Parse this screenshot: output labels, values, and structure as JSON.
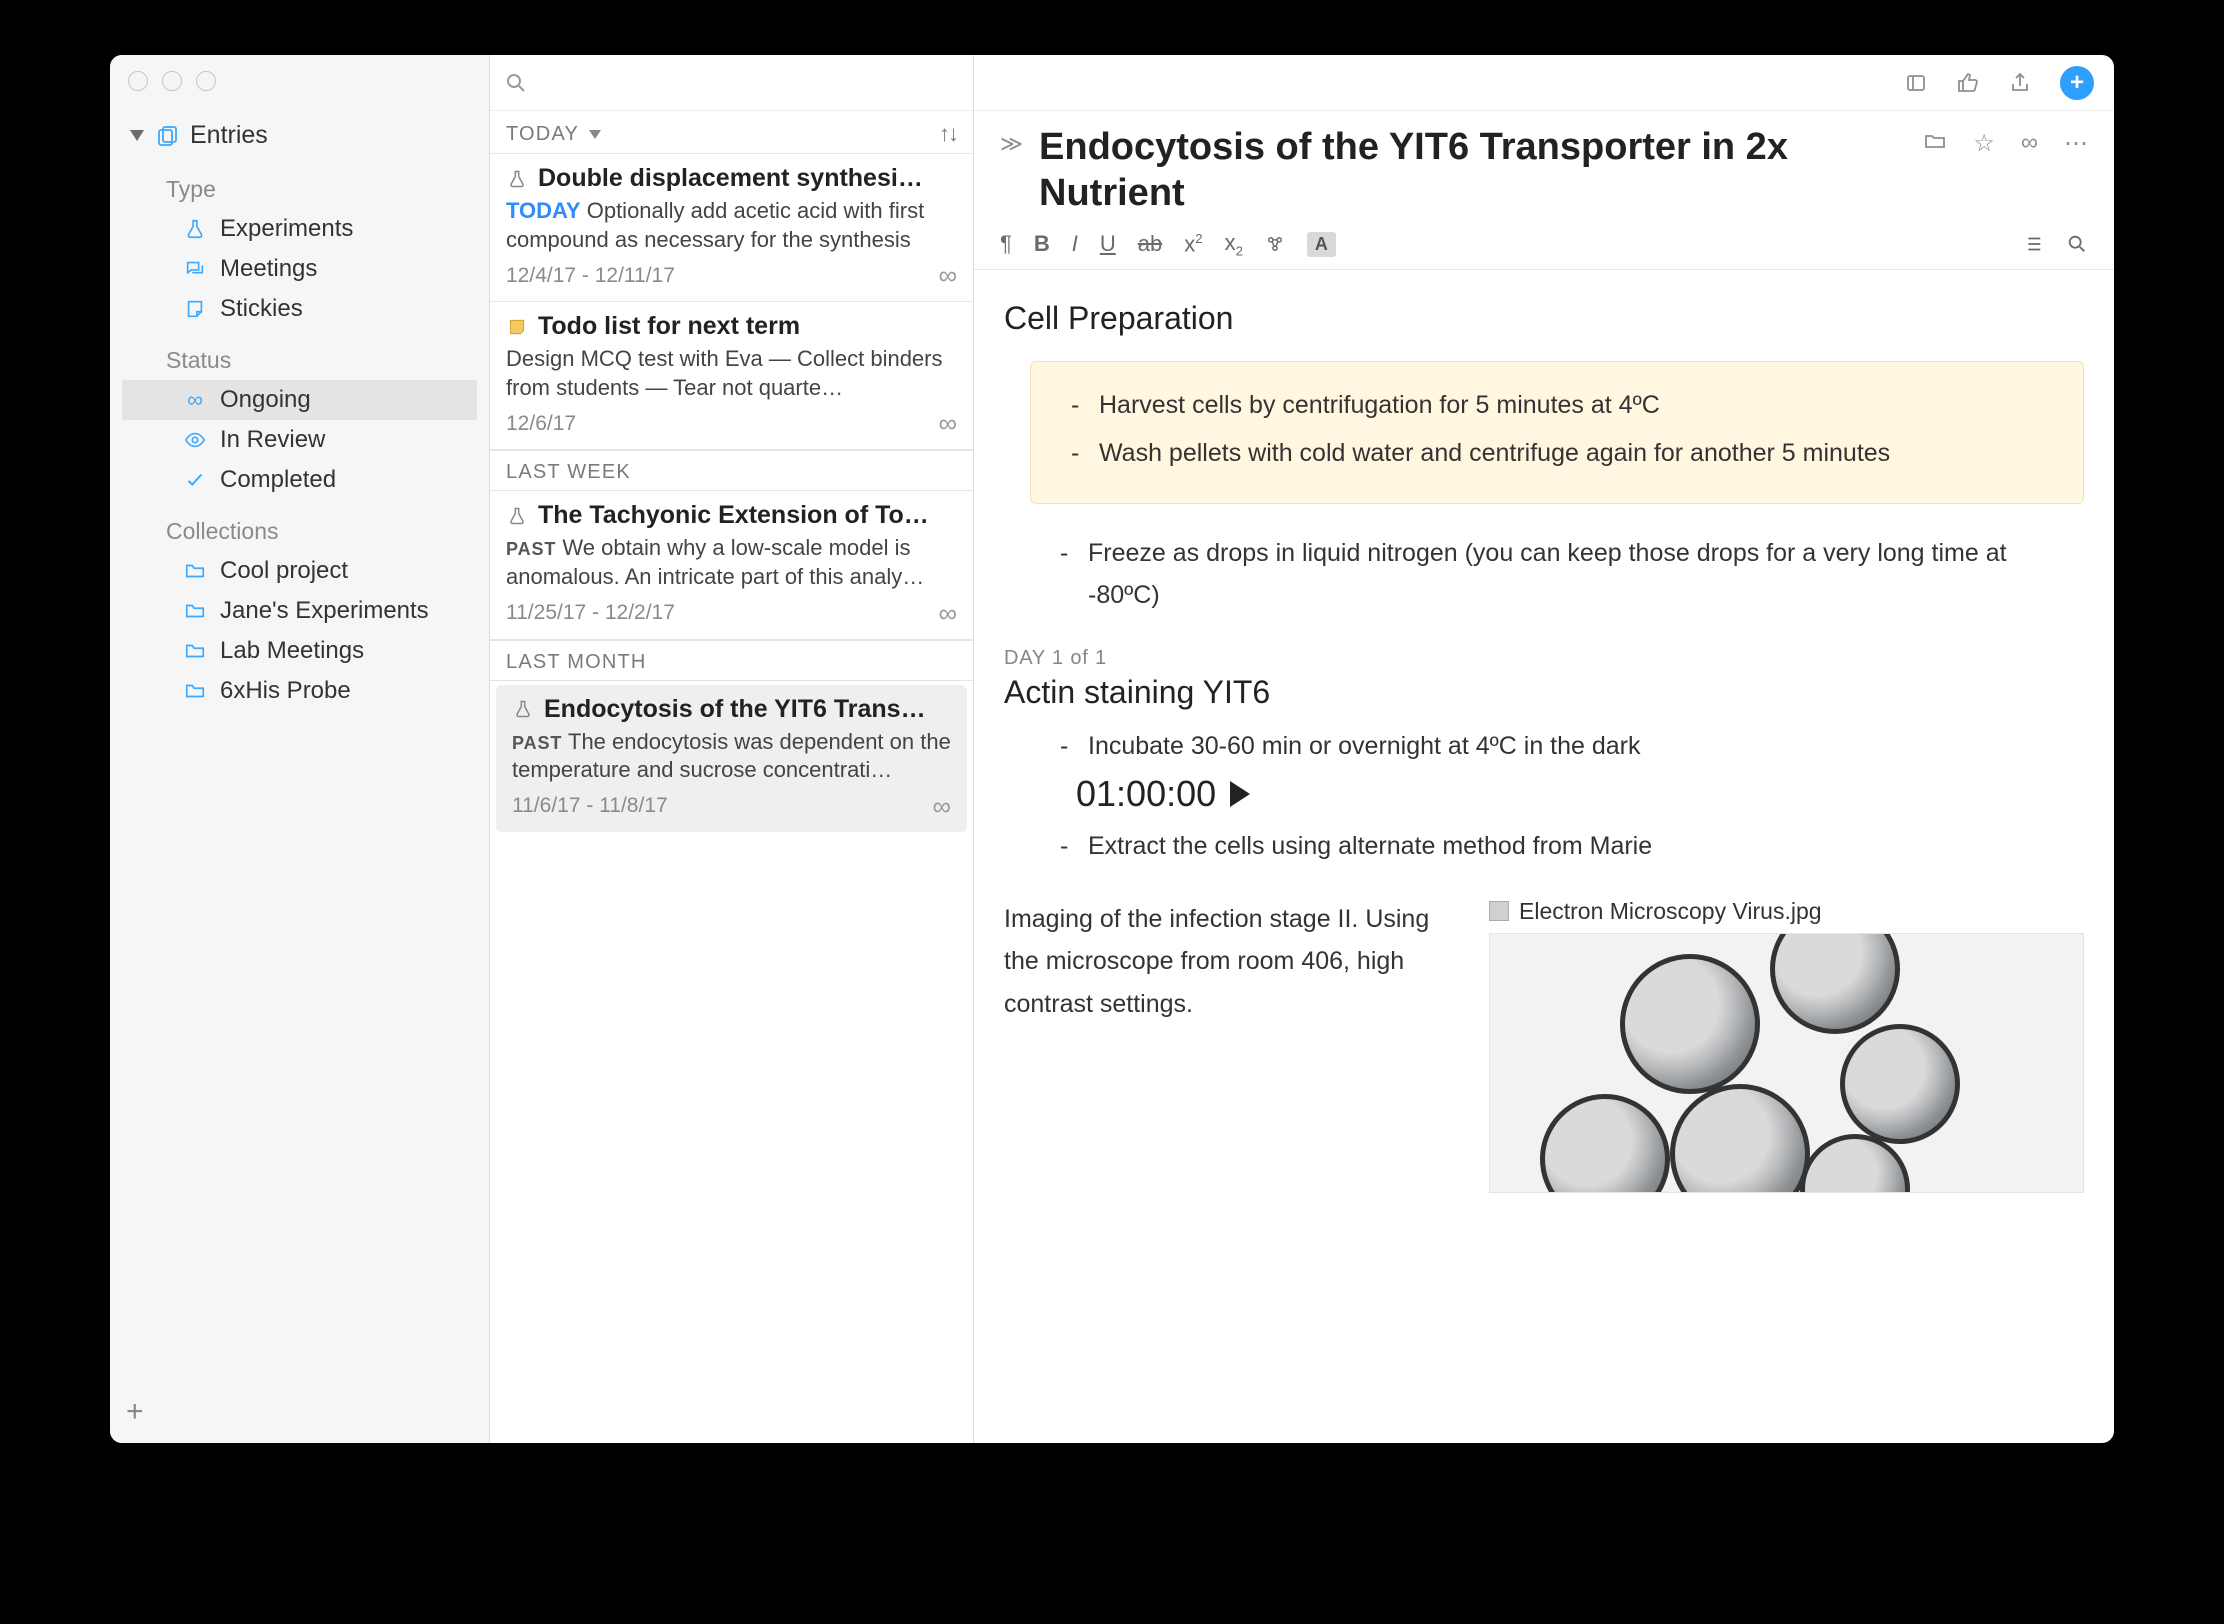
{
  "sidebar": {
    "root": "Entries",
    "sections": {
      "type_heading": "Type",
      "type_items": [
        "Experiments",
        "Meetings",
        "Stickies"
      ],
      "status_heading": "Status",
      "status_items": [
        "Ongoing",
        "In Review",
        "Completed"
      ],
      "collections_heading": "Collections",
      "collections_items": [
        "Cool project",
        "Jane's Experiments",
        "Lab Meetings",
        "6xHis Probe"
      ]
    }
  },
  "list": {
    "today_label": "TODAY",
    "lastweek_label": "LAST WEEK",
    "lastmonth_label": "LAST MONTH",
    "entries": [
      {
        "title": "Double displacement synthesi…",
        "badge": "TODAY",
        "snippet": "Optionally add acetic acid with first compound as necessary for the synthesis",
        "date": "12/4/17 - 12/11/17"
      },
      {
        "title": "Todo list for next term",
        "snippet": "Design MCQ test with Eva — Collect binders from students — Tear not quarte…",
        "date": "12/6/17"
      },
      {
        "title": "The Tachyonic Extension of To…",
        "past": "PAST",
        "snippet": "We obtain why a low-scale model is anomalous. An intricate part of this analy…",
        "date": "11/25/17 - 12/2/17"
      },
      {
        "title": "Endocytosis of the YIT6 Trans…",
        "past": "PAST",
        "snippet": "The endocytosis was dependent on the temperature and sucrose concentrati…",
        "date": "11/6/17 - 11/8/17"
      }
    ]
  },
  "editor": {
    "title": "Endocytosis of the YIT6 Transporter in 2x Nutrient",
    "section1": "Cell Preparation",
    "callout": [
      "Harvest cells by centrifugation for 5 minutes at 4ºC",
      "Wash pellets with cold water and centrifuge again for another 5 minutes"
    ],
    "freeze": "Freeze as drops in liquid nitrogen (you can keep those drops for a very long time at -80ºC)",
    "day_label": "DAY 1 of 1",
    "section2": "Actin staining YIT6",
    "steps2": [
      "Incubate 30-60 min or overnight at 4ºC in the dark",
      "Extract the cells using alternate method from Marie"
    ],
    "timer": "01:00:00",
    "imaging_text": "Imaging of the infection stage II. Using the microscope from room 406, high contrast settings.",
    "image_caption": "Electron Microscopy Virus.jpg",
    "format_highlight": "A"
  }
}
